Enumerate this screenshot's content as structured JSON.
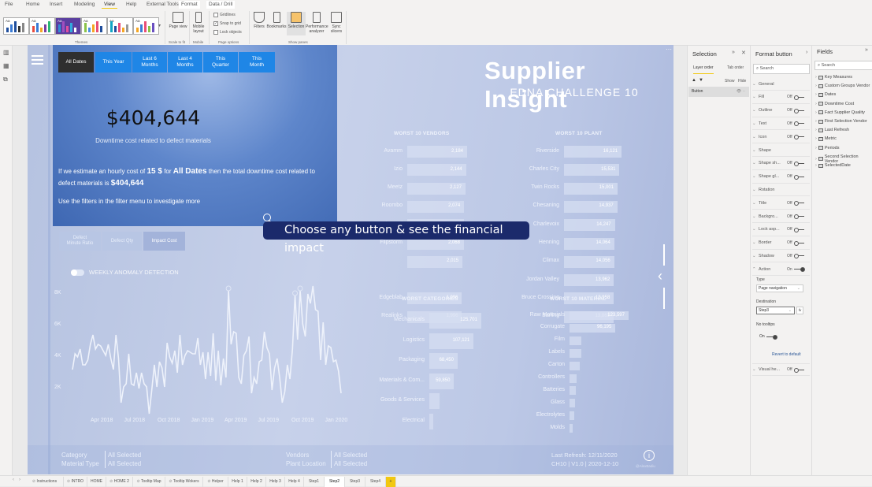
{
  "ribbon_tabs": [
    "File",
    "Home",
    "Insert",
    "Modeling",
    "View",
    "Help",
    "External Tools",
    "Format",
    "Data / Drill"
  ],
  "ribbon_active_tab": "View",
  "ribbon": {
    "themes_label": "Themes",
    "page_view": "Page view",
    "scale_label": "Scale to fit",
    "mobile_layout": "Mobile layout",
    "mobile_label": "Mobile",
    "gridlines": "Gridlines",
    "snap": "Snap to grid",
    "lock": "Lock objects",
    "page_options_label": "Page options",
    "filters": "Filters",
    "bookmarks": "Bookmarks",
    "selection": "Selection",
    "performance": "Performance analyzer",
    "sync": "Sync slicers",
    "show_panes_label": "Show panes",
    "snap_checked": true,
    "gridlines_checked": false,
    "lock_checked": false
  },
  "report": {
    "title": "Supplier Insight",
    "subtitle": "EDNA CHALLENGE 10",
    "date_buttons": [
      "All Dates",
      "This Year",
      "Last 6 Months",
      "Last 4 Months",
      "This Quarter",
      "This Month"
    ],
    "active_date": "All Dates",
    "kpi_value": "$404,644",
    "kpi_caption": "Downtime cost related to defect materials",
    "para1_a": "If we estimate an hourly cost of ",
    "para1_cost": "15 $",
    "para1_b": " for ",
    "para1_period": "All Dates",
    "para1_c": " then the total downtime cost related to defect materials is ",
    "para1_value": "$404,644",
    "para2": "Use the filters in the filter menu to investigate more",
    "metric_buttons": [
      "Defect Minute Ratio",
      "Defect Qty",
      "Impact Cost"
    ],
    "active_metric": "Impact Cost",
    "tooltip": "Choose any button & see the financial impact",
    "anomaly_label": "WEEKLY ANOMALY DETECTION",
    "footer": {
      "category_label": "Category",
      "category_value": "All Selected",
      "material_label": "Material Type",
      "material_value": "All Selected",
      "vendors_label": "Vendors",
      "vendors_value": "All Selected",
      "plant_label": "Plant Location",
      "plant_value": "All Selected",
      "refresh": "Last Refresh: 12/11/2020",
      "version": "CH10 | V1.0 | 2020-12-10",
      "credit": "@AlexBadiu"
    }
  },
  "chart_data": [
    {
      "type": "bar",
      "title": "WORST 10 VENDORS",
      "categories": [
        "Avamm",
        "Izio",
        "Meetz",
        "Roombo",
        "Blogpad",
        "Flipstorm",
        "",
        "",
        "Edgeblab",
        "Realinks"
      ],
      "values": [
        2184,
        2144,
        2127,
        2074,
        2073,
        2068,
        2015,
        null,
        1996,
        1996
      ],
      "labels": [
        "2,184",
        "2,144",
        "2,127",
        "2,074",
        "2,073",
        "2,068",
        "2,015",
        "",
        "1,996",
        "1,996"
      ]
    },
    {
      "type": "bar",
      "title": "WORST 10 PLANT",
      "categories": [
        "Riverside",
        "Charles City",
        "Twin Rocks",
        "Chesaning",
        "Charlevoix",
        "Henning",
        "Climax",
        "Jordan Valley",
        "Bruce Crossing",
        "Barling"
      ],
      "values": [
        16121,
        15531,
        15001,
        14937,
        14247,
        14064,
        14056,
        13962,
        13958,
        13861
      ],
      "labels": [
        "16,121",
        "15,531",
        "15,001",
        "14,937",
        "14,247",
        "14,064",
        "14,056",
        "13,962",
        "13,958",
        "13,861"
      ]
    },
    {
      "type": "bar",
      "title": "WORST CATEGORIES",
      "categories": [
        "Mechanicals",
        "Logistics",
        "Packaging",
        "Materials & Com...",
        "Goods & Services",
        "Electrical"
      ],
      "values": [
        125701,
        107121,
        68450,
        59850,
        25000,
        10000
      ],
      "labels": [
        "125,701",
        "107,121",
        "68,450",
        "59,850",
        "",
        ""
      ]
    },
    {
      "type": "bar",
      "title": "WORST 10 MATERIAL",
      "categories": [
        "Raw Materials",
        "Corrugate",
        "Film",
        "Labels",
        "Carton",
        "Controllers",
        "Batteries",
        "Glass",
        "Electrolytes",
        "Molds"
      ],
      "values": [
        123597,
        96195,
        25000,
        24000,
        22000,
        15000,
        13000,
        11000,
        10000,
        6000
      ],
      "labels": [
        "123,597",
        "96,195",
        "",
        "",
        "",
        "",
        "",
        "",
        "",
        ""
      ]
    },
    {
      "type": "line",
      "title": "",
      "yticks": [
        "2K",
        "4K",
        "6K",
        "8K"
      ],
      "ylim": [
        0,
        9000
      ],
      "xticks": [
        "Apr 2018",
        "Jul 2018",
        "Oct 2018",
        "Jan 2019",
        "Apr 2019",
        "Jul 2019",
        "Oct 2019",
        "Jan 2020"
      ],
      "values": [
        3100,
        4100,
        3900,
        4400,
        3400,
        3400,
        3700,
        4700,
        5300,
        4400,
        4700,
        4600,
        4300,
        4000,
        4700,
        3800,
        3100,
        5300,
        3800,
        1000,
        2000,
        2200,
        4100,
        2200,
        2100,
        2900,
        1900,
        2900,
        2200,
        2000,
        300,
        1800,
        3400,
        2000,
        3600,
        3200,
        2000,
        4800,
        3900,
        3500,
        4300,
        2900,
        5300,
        3400,
        4000,
        4300,
        4200,
        4100,
        4100,
        5100,
        3400,
        4200,
        2500,
        4200,
        2700,
        5400,
        2400,
        4300,
        2100,
        3800,
        2600,
        8100,
        4700,
        5500,
        5400,
        2600,
        2200,
        4000,
        4300,
        5200,
        1600,
        2600,
        2200,
        3600,
        3700,
        5500,
        4500,
        4100,
        1800,
        3200,
        3800,
        2600,
        1000,
        1700,
        3400,
        2500,
        4400,
        7800,
        5000,
        8100,
        6000,
        5200,
        7900,
        7300,
        8400,
        6900,
        6800,
        3700,
        6100,
        3400,
        4600,
        4500,
        3600,
        3700,
        3000,
        1600
      ],
      "anomalies": [
        61,
        87,
        89
      ]
    }
  ],
  "selection_pane": {
    "title": "Selection",
    "tabs": [
      "Layer order",
      "Tab order"
    ],
    "show": "Show",
    "hide": "Hide",
    "items": [
      "Button"
    ]
  },
  "format_pane": {
    "title": "Format button",
    "search_placeholder": "Search",
    "rows": [
      {
        "name": "General"
      },
      {
        "name": "Fill",
        "state": "Off"
      },
      {
        "name": "Outline",
        "state": "Off"
      },
      {
        "name": "Text",
        "state": "Off"
      },
      {
        "name": "Icon",
        "state": "Off"
      },
      {
        "name": "Shape"
      },
      {
        "name": "Shape sh...",
        "state": "Off"
      },
      {
        "name": "Shape gl...",
        "state": "Off"
      },
      {
        "name": "Rotation"
      },
      {
        "name": "Title",
        "state": "Off"
      },
      {
        "name": "Backgro...",
        "state": "Off"
      },
      {
        "name": "Lock asp...",
        "state": "Off"
      },
      {
        "name": "Border",
        "state": "Off"
      },
      {
        "name": "Shadow",
        "state": "Off"
      },
      {
        "name": "Action",
        "state": "On",
        "expanded": true
      }
    ],
    "type_label": "Type",
    "type_value": "Page navigation",
    "destination_label": "Destination",
    "destination_value": "Step3",
    "fx": "fx",
    "tooltips_label": "No tooltips",
    "tooltips_state": "On",
    "revert": "Revert to default",
    "last_row": {
      "name": "Visual he...",
      "state": "Off"
    }
  },
  "fields_pane": {
    "title": "Fields",
    "search_placeholder": "Search",
    "items": [
      "Key Measures",
      "Custom Groups Vendor",
      "Dates",
      "Downtime Cost",
      "Fact Supplier Quality",
      "First Selection Vendor",
      "Last Refresh",
      "Metric",
      "Periods",
      "Second Selection Vendor",
      "SelectedDate"
    ]
  },
  "page_tabs": [
    "Instructions",
    "INTRO",
    "HOME",
    "HOME 2",
    "Tooltip Map",
    "Tooltip Wokers",
    "Helper",
    "Help 1",
    "Help 2",
    "Help 3",
    "Help 4",
    "Step1",
    "Step2",
    "Step3",
    "Step4",
    "+"
  ],
  "hidden_pages": [
    "Instructions",
    "INTRO",
    "HOME 2",
    "Tooltip Map",
    "Tooltip Wokers",
    "Helper"
  ],
  "active_page": "Step2",
  "colors": {
    "date_button": "#1f86e6",
    "date_active": "#2f2f2f",
    "tooltip_bg": "#1b2a6b",
    "accent": "#f2c811"
  }
}
